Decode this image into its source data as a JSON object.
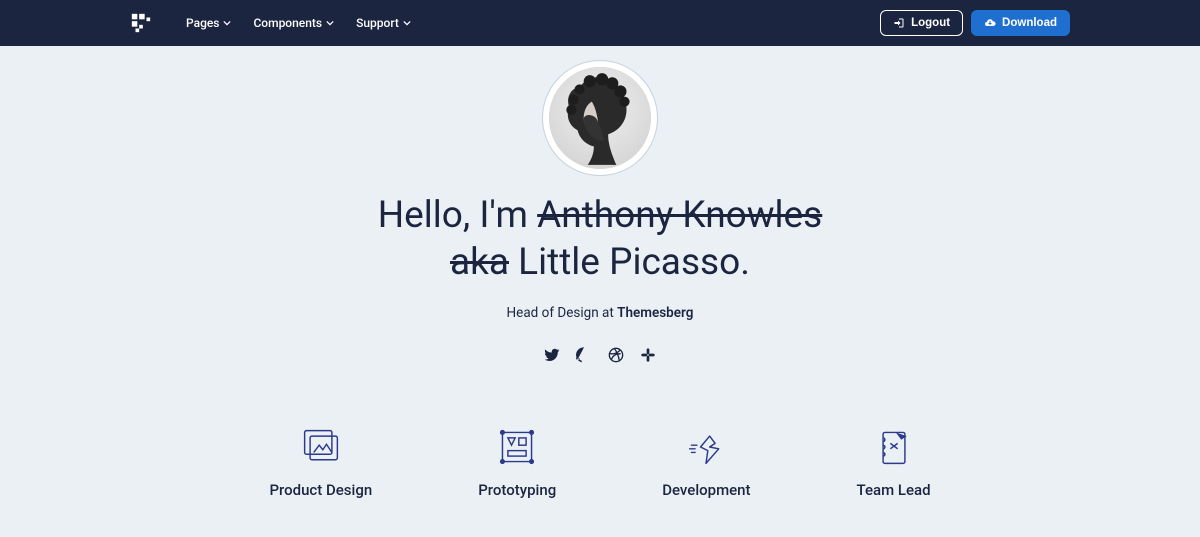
{
  "nav": {
    "items": [
      {
        "label": "Pages"
      },
      {
        "label": "Components"
      },
      {
        "label": "Support"
      }
    ],
    "logout_label": "Logout",
    "download_label": "Download"
  },
  "hero": {
    "greeting": "Hello, I'm ",
    "name_struck": "Anthony Knowles",
    "aka_struck": "aka",
    "nickname_rest": " Little Picasso.",
    "role_prefix": "Head of Design at ",
    "role_company": "Themesberg"
  },
  "socials": [
    {
      "name": "twitter"
    },
    {
      "name": "github"
    },
    {
      "name": "dribbble"
    },
    {
      "name": "slack"
    }
  ],
  "skills": [
    {
      "label": "Product Design",
      "icon": "product-design"
    },
    {
      "label": "Prototyping",
      "icon": "prototyping"
    },
    {
      "label": "Development",
      "icon": "development"
    },
    {
      "label": "Team Lead",
      "icon": "team-lead"
    }
  ]
}
